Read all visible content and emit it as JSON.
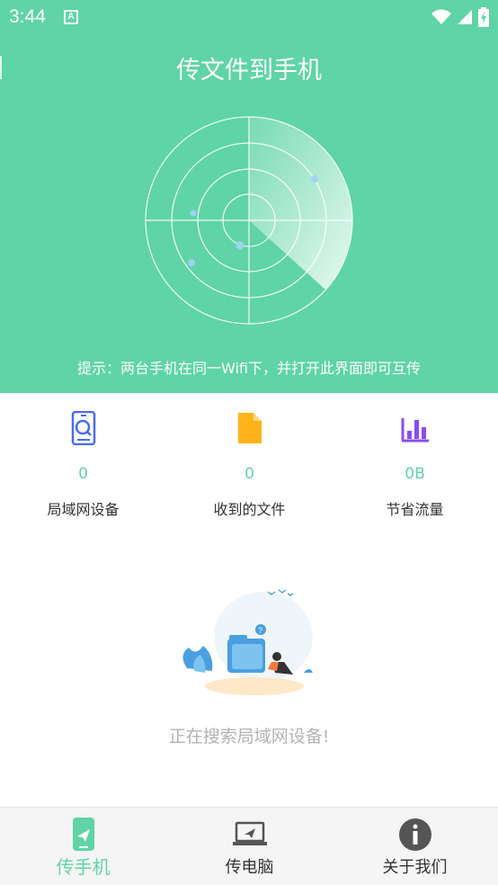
{
  "status": {
    "time": "3:44",
    "notification_icon": "A"
  },
  "header": {
    "title": "传文件到手机"
  },
  "radar": {
    "hint": "提示：两台手机在同一Wifi下，并打开此界面即可互传"
  },
  "stats": [
    {
      "icon": "phone-search-icon",
      "value": "0",
      "label": "局域网设备",
      "color": "#4a6cf0"
    },
    {
      "icon": "file-icon",
      "value": "0",
      "label": "收到的文件",
      "color": "#ffb31a"
    },
    {
      "icon": "bar-chart-icon",
      "value": "0B",
      "label": "节省流量",
      "color": "#8a4cf0"
    }
  ],
  "empty_state": {
    "message": "正在搜索局域网设备!"
  },
  "nav": [
    {
      "icon": "phone-send-icon",
      "label": "传手机",
      "active": true
    },
    {
      "icon": "laptop-send-icon",
      "label": "传电脑",
      "active": false
    },
    {
      "icon": "info-icon",
      "label": "关于我们",
      "active": false
    }
  ],
  "colors": {
    "accent": "#5fd4a6",
    "text": "#333333",
    "muted": "#b3b3b3"
  }
}
